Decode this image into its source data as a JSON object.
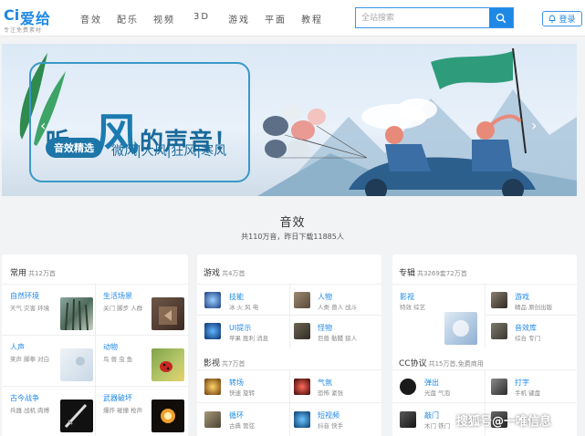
{
  "header": {
    "logo_mark": "Ci",
    "logo_text": "爱给",
    "logo_sub": "专注免费素材",
    "nav": [
      "音效",
      "配乐",
      "视频",
      "3D",
      "游戏",
      "平面",
      "教程"
    ],
    "search_placeholder": "全站搜索",
    "login_label": "登录"
  },
  "banner": {
    "title_a": "听，",
    "title_big": "风",
    "title_b": "的声音！",
    "tag": "音效精选",
    "winds": "微风|大风|狂风|寒风",
    "prev": "‹",
    "next": "›",
    "dot_count": 6,
    "active_dot": 2
  },
  "section": {
    "title": "音效",
    "subtitle": "共110万音，昨日下载11885人"
  },
  "cards": {
    "common": {
      "title": "常用",
      "count": "共12万首",
      "items": [
        {
          "title": "自然环境",
          "desc": "天气 灾害 环境"
        },
        {
          "title": "生活场景",
          "desc": "关门 脚步 人群"
        },
        {
          "title": "人声",
          "desc": "笑声 脚拳 对白"
        },
        {
          "title": "动物",
          "desc": "鸟 兽 虫 鱼"
        },
        {
          "title": "古今战争",
          "desc": "兵器 战机 肉搏"
        },
        {
          "title": "武器破坏",
          "desc": "爆炸 碰撞 枪声"
        }
      ]
    },
    "game": {
      "title": "游戏",
      "count": "共4万首",
      "items": [
        {
          "title": "技能",
          "desc": "冰 火 风 电"
        },
        {
          "title": "人物",
          "desc": "人类 兽人 战斗"
        },
        {
          "title": "UI提示",
          "desc": "苹果 胜利 消息"
        },
        {
          "title": "怪物",
          "desc": "巨兽 骷髅 狼人"
        }
      ],
      "video_title": "影视",
      "video_count": "共7万首",
      "video_items": [
        {
          "title": "转场",
          "desc": "快速 旋转"
        },
        {
          "title": "气氛",
          "desc": "恐怖 紧张"
        },
        {
          "title": "循环",
          "desc": "古典 管弦"
        },
        {
          "title": "短视频",
          "desc": "抖音 快手"
        }
      ]
    },
    "album": {
      "title": "专辑",
      "count": "共3269套72万首",
      "items": [
        {
          "title": "影视",
          "desc": "特效 综艺"
        },
        {
          "title": "游戏",
          "desc": "精品 原创出版"
        },
        {
          "title": "音效库",
          "desc": "综合 专门"
        }
      ],
      "cc_title": "CC协议",
      "cc_count": "共15万首,免费商用",
      "cc_items": [
        {
          "title": "弹出",
          "desc": "光盘 气泡"
        },
        {
          "title": "打字",
          "desc": "手机 键盘"
        },
        {
          "title": "敲门",
          "desc": "木门 铁门"
        },
        {
          "title": "",
          "desc": ""
        }
      ]
    }
  },
  "watermark": "搜狐号@一唯信息"
}
